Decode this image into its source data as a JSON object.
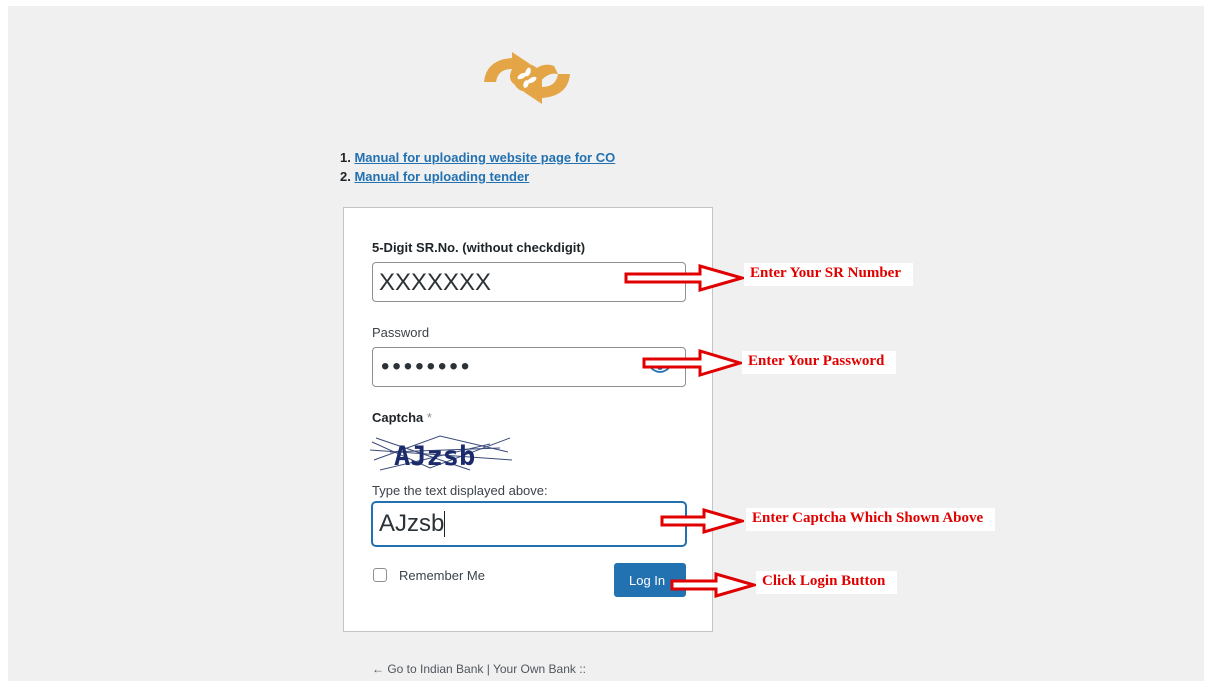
{
  "manuals": {
    "items": [
      {
        "num": "1.",
        "label": "Manual for uploading website page for CO"
      },
      {
        "num": "2.",
        "label": "Manual for uploading tender"
      }
    ]
  },
  "form": {
    "sr_label": "5-Digit SR.No. (without checkdigit)",
    "sr_value": "XXXXXXX",
    "password_label": "Password",
    "password_value": "••••••••",
    "captcha_label": "Captcha",
    "captcha_required_mark": "*",
    "captcha_image_text": "AJzsb",
    "captcha_prompt": "Type the text displayed above:",
    "captcha_value": "AJzsb",
    "remember_label": "Remember Me",
    "login_label": "Log In"
  },
  "footer": {
    "back_link": "← Go to Indian Bank | Your Own Bank ::"
  },
  "annotations": {
    "sr": "Enter Your SR Number",
    "password": "Enter Your Password",
    "captcha": "Enter Captcha Which Shown Above",
    "login": "Click Login Button"
  },
  "colors": {
    "accent": "#2271b1",
    "logo": "#e3a545",
    "annotation": "#e00000",
    "background": "#f0f0f1"
  },
  "icons": [
    "bank-logo-icon",
    "password-visibility-eye-icon",
    "arrow-right-icon"
  ]
}
